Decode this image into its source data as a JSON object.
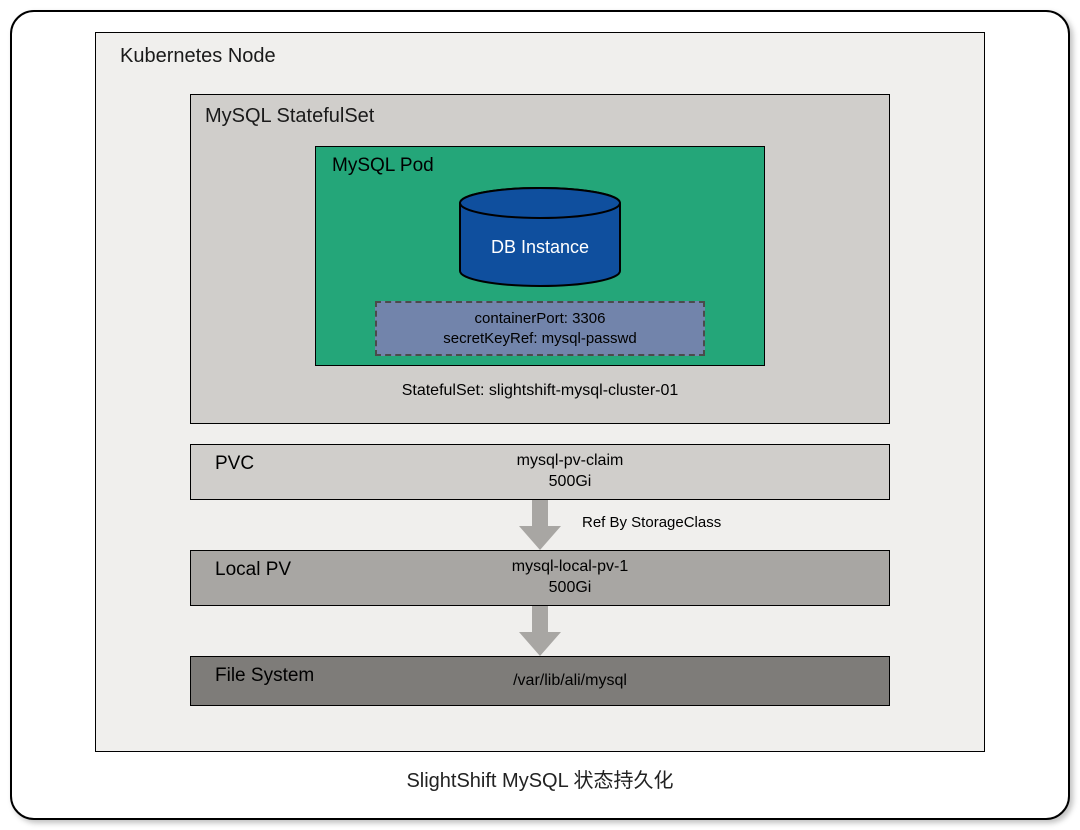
{
  "caption": "SlightShift MySQL  状态持久化",
  "node": {
    "label": "Kubernetes Node"
  },
  "statefulset": {
    "label": "MySQL StatefulSet",
    "caption": "StatefulSet: slightshift-mysql-cluster-01"
  },
  "pod": {
    "label": "MySQL Pod",
    "db_label": "DB Instance",
    "config_line1": "containerPort: 3306",
    "config_line2": "secretKeyRef: mysql-passwd"
  },
  "pvc": {
    "title": "PVC",
    "name": "mysql-pv-claim",
    "size": "500Gi"
  },
  "ref_label": "Ref By StorageClass",
  "local_pv": {
    "title": "Local PV",
    "name": "mysql-local-pv-1",
    "size": "500Gi"
  },
  "fs": {
    "title": "File System",
    "path": "/var/lib/ali/mysql"
  },
  "colors": {
    "pod_bg": "#24a679",
    "db_fill": "#0f4f9e",
    "config_bg": "#7284ab",
    "arrow": "#a8a6a3"
  }
}
